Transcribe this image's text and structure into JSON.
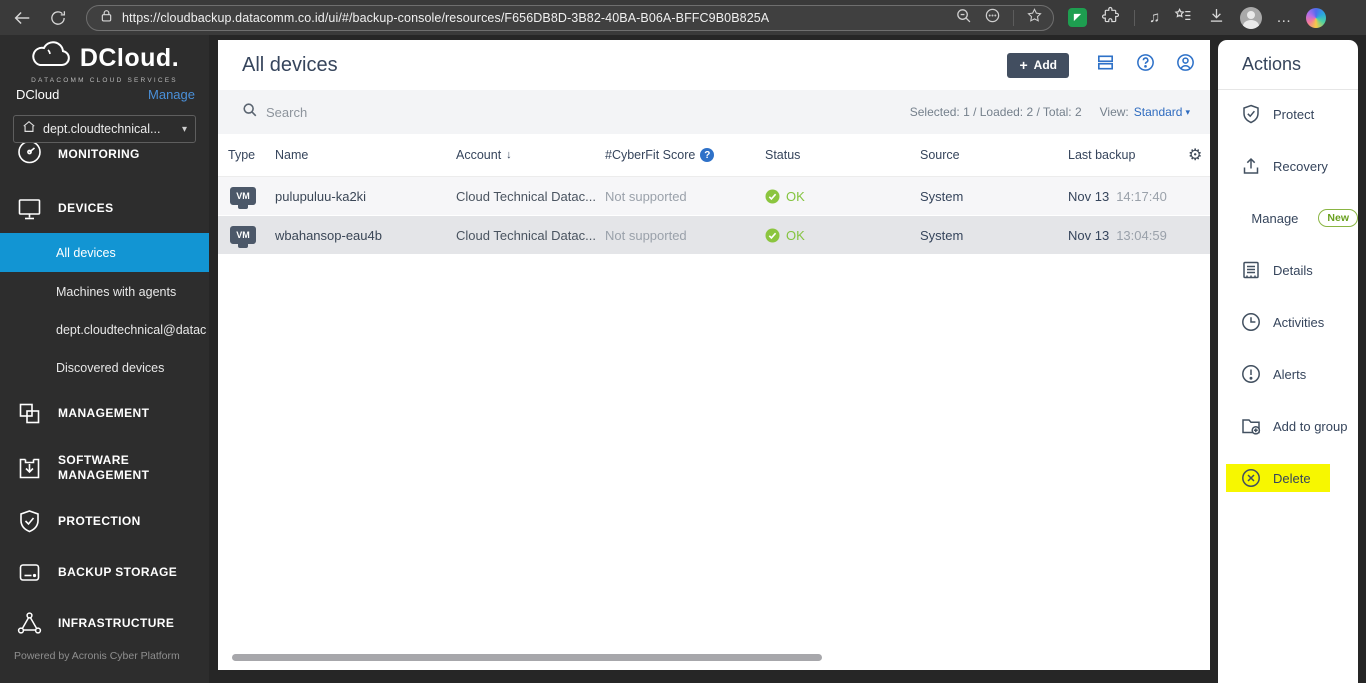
{
  "browser": {
    "url": "https://cloudbackup.datacomm.co.id/ui/#/backup-console/resources/F656DB8D-3B82-40BA-B06A-BFFC9B0B825A"
  },
  "icons": {
    "gear": "⚙",
    "chevron": "▾",
    "media": "♫",
    "dots": "…",
    "plus": "+"
  },
  "sidebar": {
    "brand_name": "DCloud.",
    "brand_tagline": "DATACOMM CLOUD SERVICES",
    "account_label": "DCloud",
    "manage_link": "Manage",
    "tenant": "dept.cloudtechnical...",
    "nav": [
      {
        "label": "MONITORING"
      },
      {
        "label": "DEVICES"
      },
      {
        "label": "All devices"
      },
      {
        "label": "Machines with agents"
      },
      {
        "label": "dept.cloudtechnical@datac"
      },
      {
        "label": "Discovered devices"
      },
      {
        "label": "MANAGEMENT"
      },
      {
        "label": "SOFTWARE MANAGEMENT"
      },
      {
        "label": "PROTECTION"
      },
      {
        "label": "BACKUP STORAGE"
      },
      {
        "label": "INFRASTRUCTURE"
      }
    ],
    "footer": "Powered by Acronis Cyber Platform"
  },
  "header": {
    "title": "All devices",
    "add_label": "Add"
  },
  "toolbar": {
    "search_placeholder": "Search",
    "selection_summary": "Selected: 1 / Loaded: 2 / Total: 2",
    "view_label": "View:",
    "view_value": "Standard"
  },
  "table": {
    "columns": {
      "type": "Type",
      "name": "Name",
      "account": "Account",
      "cyberfit": "#CyberFit Score",
      "status": "Status",
      "source": "Source",
      "last_backup": "Last backup"
    },
    "sort_arrow": "↓",
    "rows": [
      {
        "type_badge": "VM",
        "name": "pulupuluu-ka2ki",
        "account": "Cloud Technical Datac...",
        "cyberfit": "Not supported",
        "status": "OK",
        "source": "System",
        "date": "Nov 13",
        "time": "14:17:40"
      },
      {
        "type_badge": "VM",
        "name": "wbahansop-eau4b",
        "account": "Cloud Technical Datac...",
        "cyberfit": "Not supported",
        "status": "OK",
        "source": "System",
        "date": "Nov 13",
        "time": "13:04:59"
      }
    ]
  },
  "actions": {
    "title": "Actions",
    "items": [
      {
        "label": "Protect"
      },
      {
        "label": "Recovery"
      },
      {
        "label": "Manage",
        "badge": "New"
      },
      {
        "label": "Details"
      },
      {
        "label": "Activities"
      },
      {
        "label": "Alerts"
      },
      {
        "label": "Add to group"
      },
      {
        "label": "Delete"
      }
    ]
  },
  "colors": {
    "selected_nav_blue": "#1295d3",
    "accent_blue": "#2e71c8",
    "ok_green": "#8bc53f",
    "new_badge_green": "#76ab28",
    "highlight_yellow": "#f7f700",
    "add_button_bg": "#424e60"
  }
}
